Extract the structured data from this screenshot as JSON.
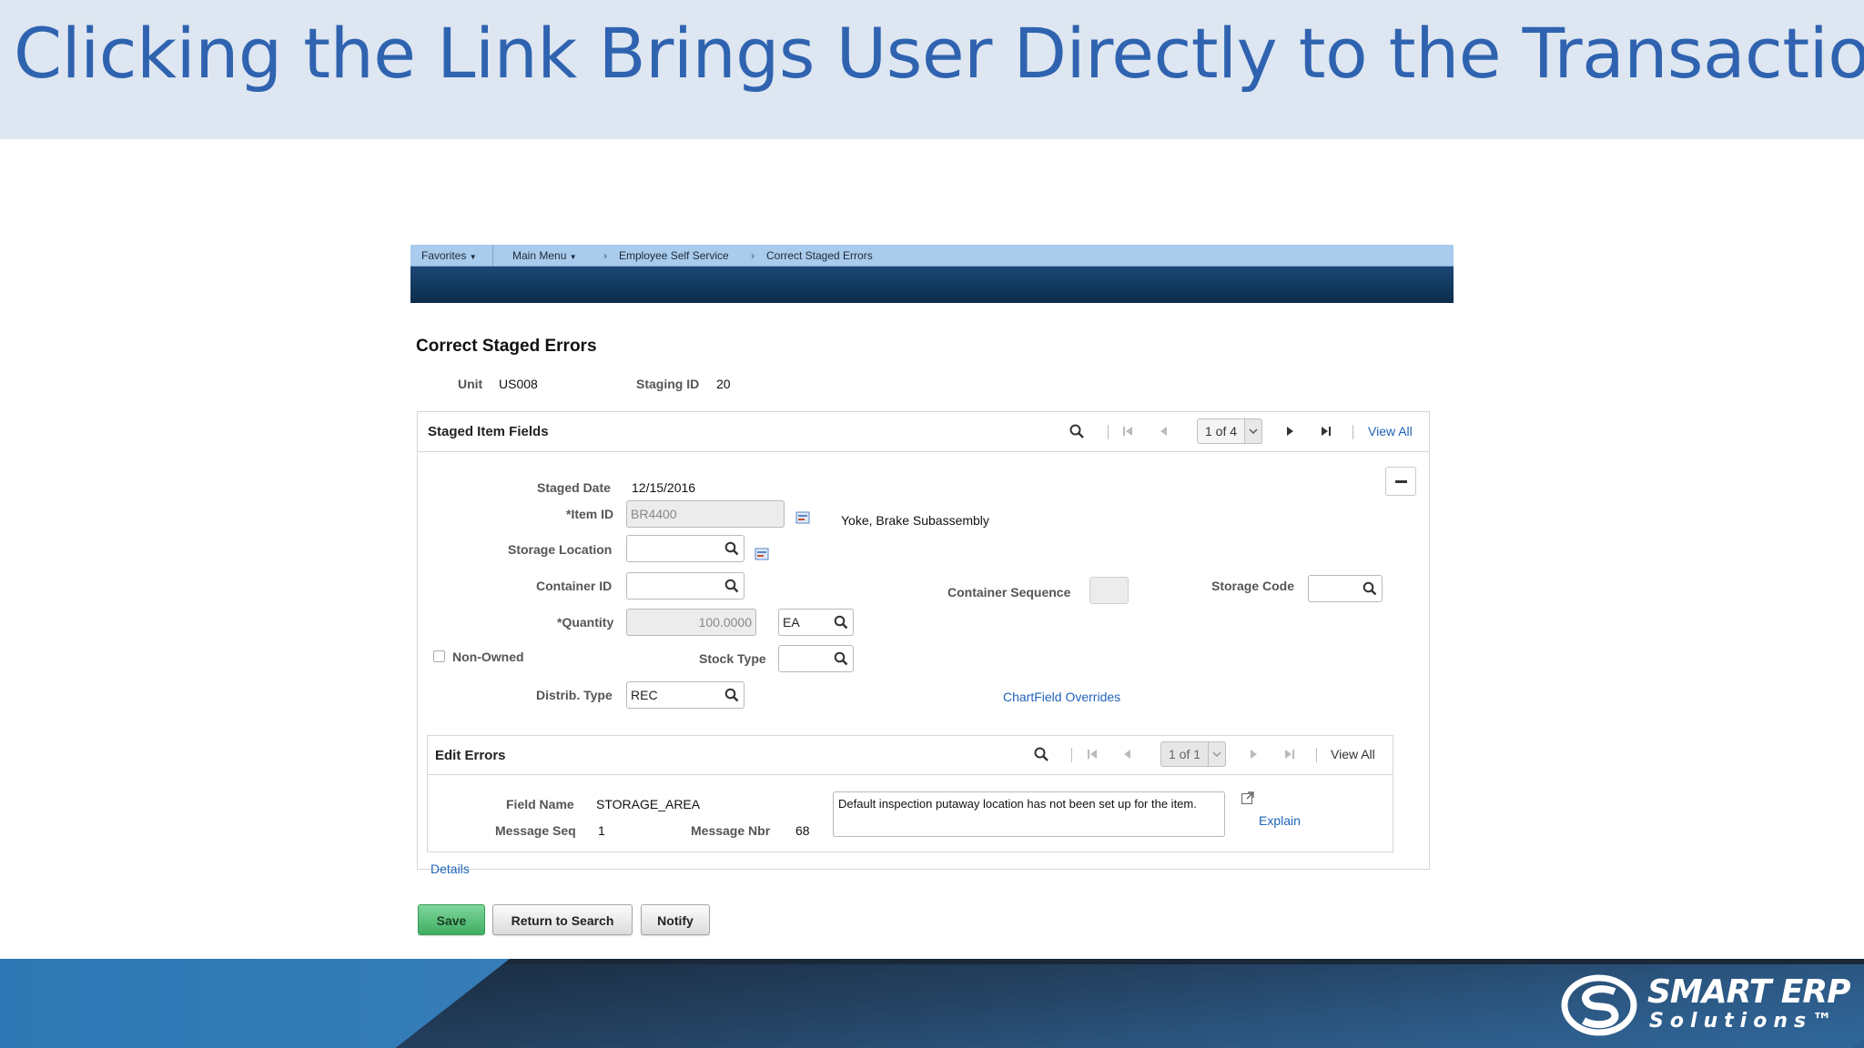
{
  "slide": {
    "title": "Clicking the Link Brings User Directly to the Transaction",
    "logo": {
      "line1": "SMART ERP",
      "line2": "Solutions™"
    }
  },
  "nav": {
    "favorites": "Favorites",
    "main_menu": "Main Menu",
    "crumb1": "Employee Self Service",
    "crumb2": "Correct Staged Errors"
  },
  "page": {
    "title": "Correct Staged Errors",
    "unit_label": "Unit",
    "unit_value": "US008",
    "staging_label": "Staging ID",
    "staging_value": "20"
  },
  "staged": {
    "header": "Staged Item Fields",
    "pager": "1 of 4",
    "view_all": "View All",
    "staged_date_label": "Staged Date",
    "staged_date_value": "12/15/2016",
    "item_id_label": "*Item ID",
    "item_id_value": "BR4400",
    "item_desc": "Yoke, Brake Subassembly",
    "storage_location_label": "Storage Location",
    "storage_location_value": "",
    "container_id_label": "Container ID",
    "container_id_value": "",
    "container_seq_label": "Container Sequence",
    "storage_code_label": "Storage Code",
    "storage_code_value": "",
    "quantity_label": "*Quantity",
    "quantity_value": "100.0000",
    "uom_value": "EA",
    "non_owned_label": "Non-Owned",
    "non_owned_checked": false,
    "stock_type_label": "Stock Type",
    "stock_type_value": "",
    "distrib_type_label": "Distrib. Type",
    "distrib_type_value": "REC",
    "chartfield_link": "ChartField Overrides",
    "details_link": "Details"
  },
  "errors": {
    "header": "Edit Errors",
    "pager": "1 of 1",
    "view_all": "View All",
    "field_name_label": "Field Name",
    "field_name_value": "STORAGE_AREA",
    "message_seq_label": "Message Seq",
    "message_seq_value": "1",
    "message_nbr_label": "Message Nbr",
    "message_nbr_value": "68",
    "message_text": "Default inspection putaway location has not been set up for the item.",
    "explain_link": "Explain"
  },
  "buttons": {
    "save": "Save",
    "return": "Return to Search",
    "notify": "Notify"
  },
  "colors": {
    "title_text": "#2f63b0",
    "title_band": "#dde6f1",
    "nav_bar": "#a9cbec",
    "banner": "#123a61",
    "link": "#1f63b8",
    "save_button": "#3fae61"
  }
}
